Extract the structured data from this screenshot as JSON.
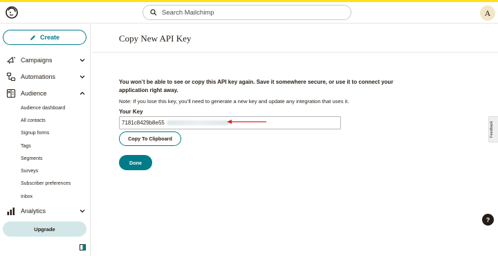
{
  "header": {
    "search_placeholder": "Search Mailchimp",
    "avatar_initial": "A",
    "accent_color": "#ffe01b"
  },
  "sidebar": {
    "create_label": "Create",
    "nav": [
      {
        "label": "Campaigns",
        "icon": "campaigns-icon",
        "expanded": false
      },
      {
        "label": "Automations",
        "icon": "automations-icon",
        "expanded": false
      },
      {
        "label": "Audience",
        "icon": "audience-icon",
        "expanded": true
      },
      {
        "label": "Analytics",
        "icon": "analytics-icon",
        "expanded": false
      }
    ],
    "audience_items": [
      "Audience dashboard",
      "All contacts",
      "Signup forms",
      "Tags",
      "Segments",
      "Surveys",
      "Subscriber preferences",
      "Inbox"
    ],
    "upgrade_label": "Upgrade"
  },
  "main": {
    "title": "Copy New API Key",
    "warning": "You won’t be able to see or copy this API key again. Save it somewhere secure, or use it to connect your application right away.",
    "note": "Note: If you lose this key, you’ll need to generate a new key and update any integration that uses it.",
    "key_label": "Your Key",
    "key_value": "7181c8429b8e55",
    "copy_label": "Copy To Clipboard",
    "done_label": "Done",
    "brand_color": "#007c89",
    "arrow_color": "#d7262b"
  },
  "feedback_label": "Feedback",
  "help_label": "?"
}
